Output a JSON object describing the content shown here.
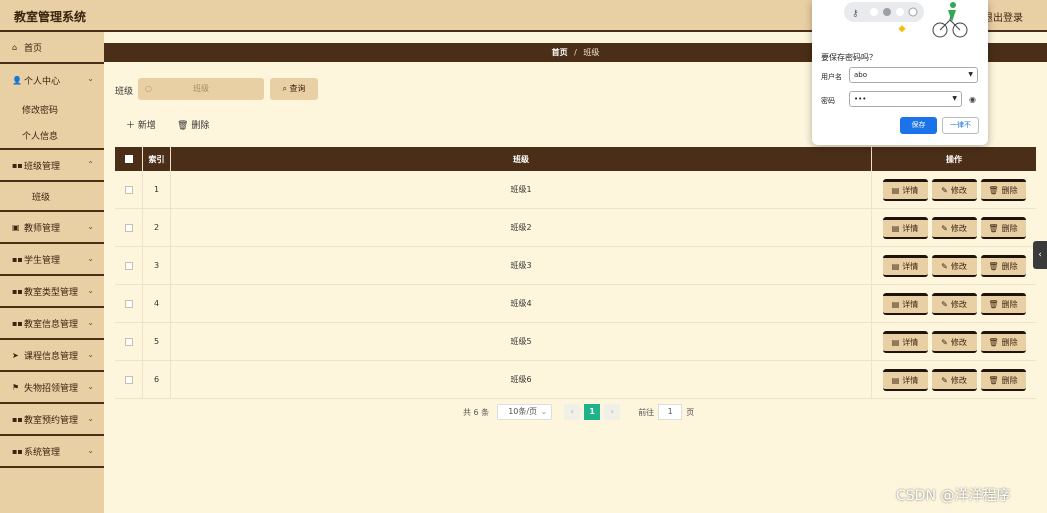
{
  "app": {
    "title": "教室管理系统",
    "logout": "退出登录"
  },
  "sidebar": {
    "items": [
      {
        "label": "首页",
        "icon": "home-icon"
      },
      {
        "label": "个人中心",
        "icon": "user-icon",
        "children": [
          "修改密码",
          "个人信息"
        ]
      },
      {
        "label": "班级管理",
        "icon": "grid-icon",
        "children": [
          "班级"
        ]
      },
      {
        "label": "教师管理",
        "icon": "lock-icon"
      },
      {
        "label": "学生管理",
        "icon": "grid-icon"
      },
      {
        "label": "教室类型管理",
        "icon": "grid-icon"
      },
      {
        "label": "教室信息管理",
        "icon": "grid-icon"
      },
      {
        "label": "课程信息管理",
        "icon": "send-icon"
      },
      {
        "label": "失物招领管理",
        "icon": "flag-icon"
      },
      {
        "label": "教室预约管理",
        "icon": "grid-icon"
      },
      {
        "label": "系统管理",
        "icon": "grid-icon"
      }
    ]
  },
  "breadcrumb": {
    "home": "首页",
    "sep": "/",
    "current": "班级"
  },
  "search": {
    "label": "班级",
    "placeholder": "班级",
    "button": "查询"
  },
  "toolbar": {
    "add": "新增",
    "delete": "删除"
  },
  "table": {
    "headers": {
      "index": "索引",
      "name": "班级",
      "ops": "操作"
    },
    "rows": [
      {
        "index": "1",
        "name": "班级1"
      },
      {
        "index": "2",
        "name": "班级2"
      },
      {
        "index": "3",
        "name": "班级3"
      },
      {
        "index": "4",
        "name": "班级4"
      },
      {
        "index": "5",
        "name": "班级5"
      },
      {
        "index": "6",
        "name": "班级6"
      }
    ],
    "op_labels": {
      "detail": "详情",
      "edit": "修改",
      "delete": "删除"
    }
  },
  "pagination": {
    "total": "共 6 条",
    "page_size": "10条/页",
    "current": "1",
    "goto": "前往",
    "goto_value": "1",
    "unit": "页"
  },
  "password_popup": {
    "title": "要保存密码吗？",
    "username_label": "用户名",
    "username": "abo",
    "password_label": "密码",
    "password": "•••",
    "save": "保存",
    "never": "一律不"
  },
  "watermark": "CSDN @洋洋程序",
  "colors": {
    "accent": "#e9cfa4",
    "dark": "#4a2e17",
    "bg": "#fdf6dc",
    "pager": "#1fb38a",
    "save": "#1a73e8"
  }
}
